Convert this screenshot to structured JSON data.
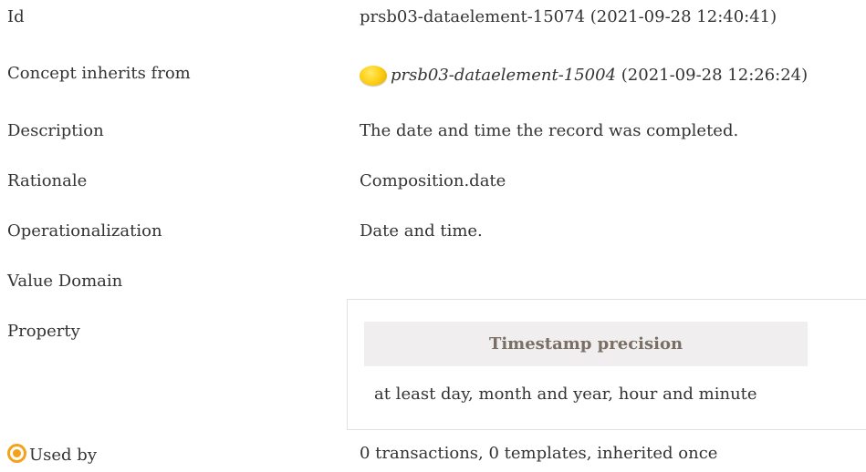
{
  "rows": {
    "id": {
      "label": "Id",
      "value": "prsb03-dataelement-15074 (2021-09-28 12:40:41)"
    },
    "inherits": {
      "label": "Concept inherits from",
      "ref": "prsb03-dataelement-15004",
      "date": " (2021-09-28 12:26:24)",
      "icon": "yellow-circle-icon"
    },
    "description": {
      "label": "Description",
      "value": "The date and time the record was completed."
    },
    "rationale": {
      "label": "Rationale",
      "value": "Composition.date"
    },
    "operationalization": {
      "label": "Operationalization",
      "value": "Date and time."
    },
    "value_domain": {
      "label": "Value Domain"
    },
    "property": {
      "label": "Property",
      "header": "Timestamp precision",
      "value": "at least day, month and year, hour and minute"
    },
    "used_by": {
      "label": "Used by",
      "value": "0 transactions, 0 templates, inherited once",
      "icon": "target-icon"
    }
  },
  "colors": {
    "text": "#333333",
    "header_bg": "#f0eeee",
    "header_text": "#7a6f64",
    "accent_orange": "#f5a21b",
    "yellow": "#ffd21a"
  }
}
